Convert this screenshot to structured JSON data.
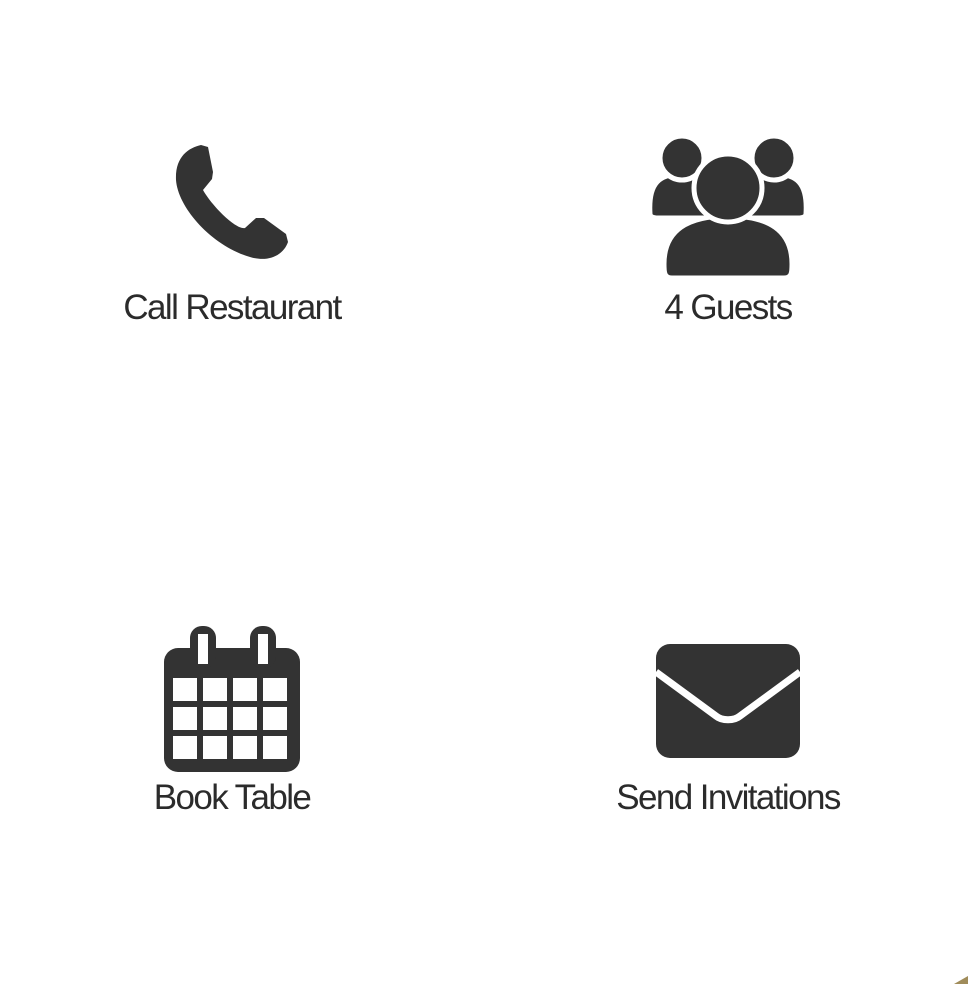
{
  "actions": {
    "call": {
      "label": "Call Restaurant",
      "icon": "phone-icon"
    },
    "guests": {
      "label": "4 Guests",
      "icon": "guests-icon"
    },
    "book": {
      "label": "Book Table",
      "icon": "calendar-icon"
    },
    "invite": {
      "label": "Send Invitations",
      "icon": "envelope-icon"
    }
  },
  "colors": {
    "background": "#ffffff",
    "icon": "#333333",
    "label": "#2b2b2b",
    "corner_accent": "#a08c5a"
  }
}
